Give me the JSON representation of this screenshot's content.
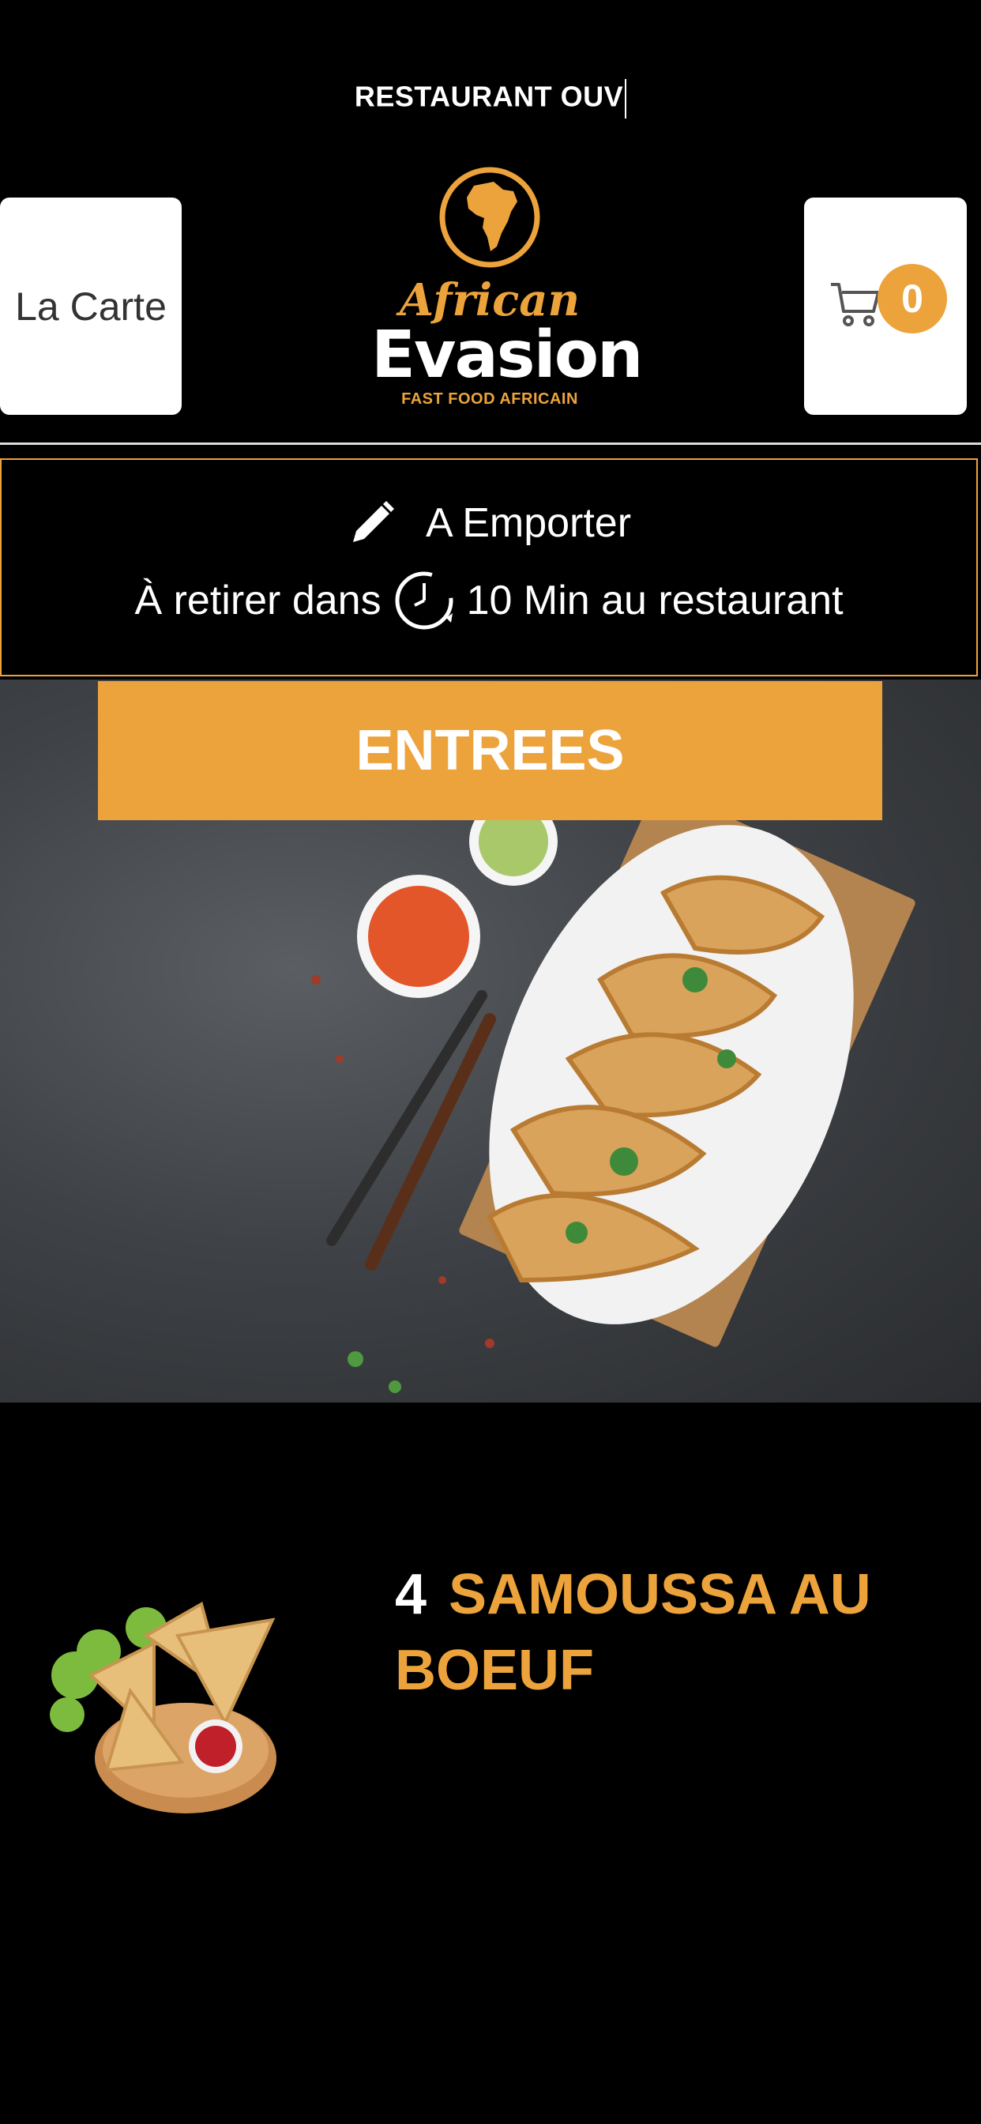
{
  "status": {
    "ticker_text": "RESTAURANT OUV"
  },
  "header": {
    "menu_button_label": "La Carte",
    "brand": {
      "line1": "African",
      "line2": "Evasion",
      "tagline": "FAST FOOD AFRICAIN"
    },
    "cart_count": "0",
    "icons": {
      "cart": "cart-icon",
      "logo": "africa-map-icon"
    }
  },
  "order_mode": {
    "mode_label": "A Emporter",
    "pickup_prefix": "À retirer dans",
    "pickup_suffix": "10 Min au restaurant",
    "icons": {
      "edit": "pencil-icon",
      "time": "clock-icon"
    }
  },
  "category": {
    "label": "ENTREES"
  },
  "product": {
    "quantity": "4",
    "name": "SAMOUSSA AU BOEUF"
  },
  "colors": {
    "accent": "#eda33b",
    "background": "#000000",
    "card": "#ffffff"
  }
}
